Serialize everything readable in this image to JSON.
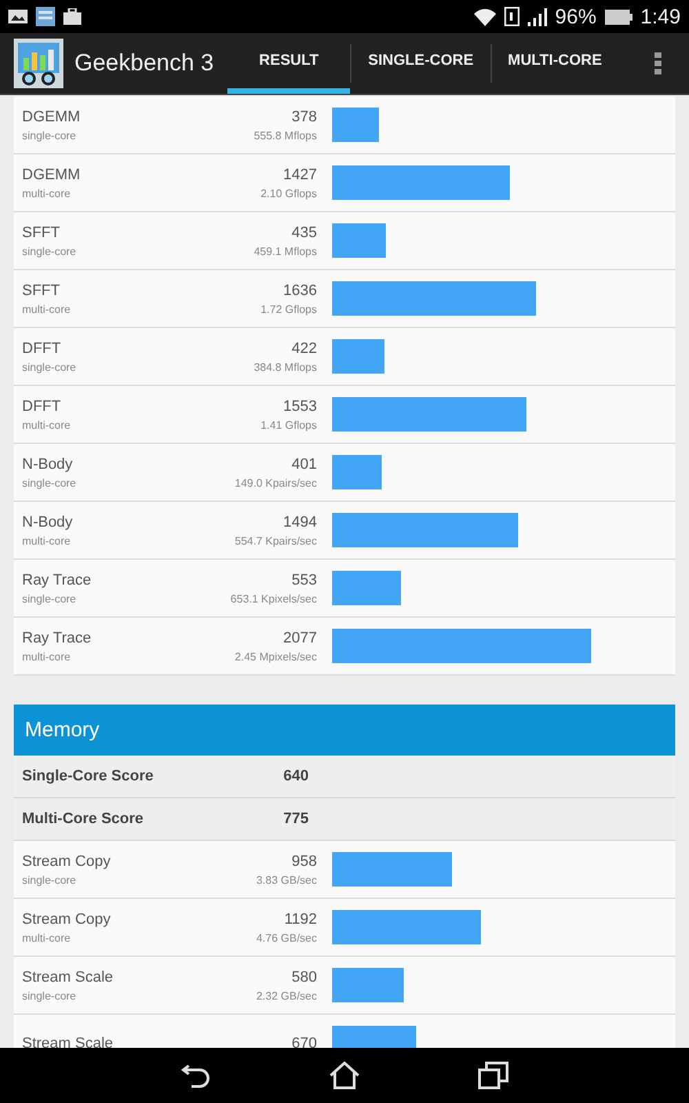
{
  "status_bar": {
    "battery": "96%",
    "time": "1:49"
  },
  "app_bar": {
    "title": "Geekbench 3",
    "tabs": [
      {
        "label": "RESULT",
        "selected": true
      },
      {
        "label": "SINGLE-CORE",
        "selected": false
      },
      {
        "label": "MULTI-CORE",
        "selected": false
      }
    ]
  },
  "sections": [
    {
      "rows": [
        {
          "name": "DGEMM",
          "mode": "single-core",
          "score": "378",
          "rate": "555.8 Mflops"
        },
        {
          "name": "DGEMM",
          "mode": "multi-core",
          "score": "1427",
          "rate": "2.10 Gflops"
        },
        {
          "name": "SFFT",
          "mode": "single-core",
          "score": "435",
          "rate": "459.1 Mflops"
        },
        {
          "name": "SFFT",
          "mode": "multi-core",
          "score": "1636",
          "rate": "1.72 Gflops"
        },
        {
          "name": "DFFT",
          "mode": "single-core",
          "score": "422",
          "rate": "384.8 Mflops"
        },
        {
          "name": "DFFT",
          "mode": "multi-core",
          "score": "1553",
          "rate": "1.41 Gflops"
        },
        {
          "name": "N-Body",
          "mode": "single-core",
          "score": "401",
          "rate": "149.0 Kpairs/sec"
        },
        {
          "name": "N-Body",
          "mode": "multi-core",
          "score": "1494",
          "rate": "554.7 Kpairs/sec"
        },
        {
          "name": "Ray Trace",
          "mode": "single-core",
          "score": "553",
          "rate": "653.1 Kpixels/sec"
        },
        {
          "name": "Ray Trace",
          "mode": "multi-core",
          "score": "2077",
          "rate": "2.45 Mpixels/sec"
        }
      ]
    },
    {
      "title": "Memory",
      "scores": [
        {
          "label": "Single-Core Score",
          "value": "640"
        },
        {
          "label": "Multi-Core Score",
          "value": "775"
        }
      ],
      "rows": [
        {
          "name": "Stream Copy",
          "mode": "single-core",
          "score": "958",
          "rate": "3.83 GB/sec"
        },
        {
          "name": "Stream Copy",
          "mode": "multi-core",
          "score": "1192",
          "rate": "4.76 GB/sec"
        },
        {
          "name": "Stream Scale",
          "mode": "single-core",
          "score": "580",
          "rate": "2.32 GB/sec"
        },
        {
          "name": "Stream Scale",
          "score": "670"
        }
      ]
    }
  ]
}
